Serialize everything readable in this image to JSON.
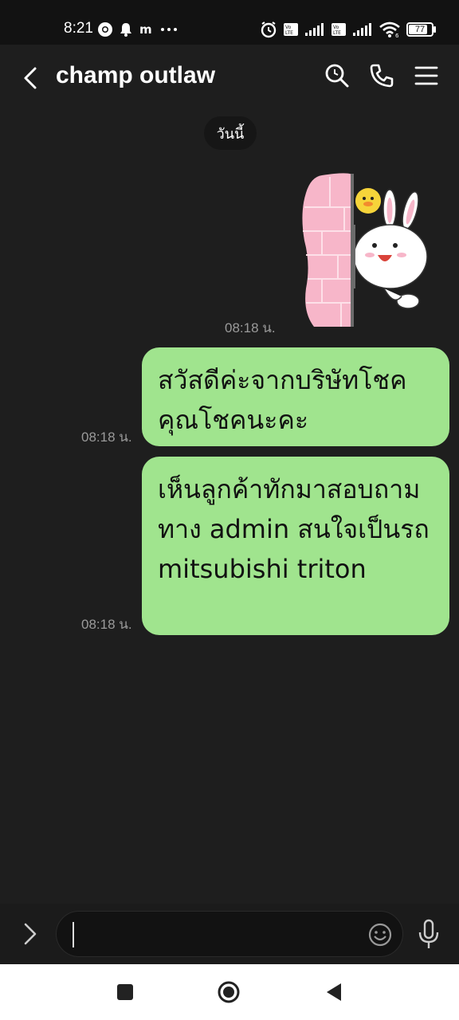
{
  "status": {
    "time": "8:21",
    "battery": "77",
    "icons_left": [
      "chrome-icon",
      "bell-icon",
      "m-app-icon",
      "more-icon"
    ],
    "icons_right": [
      "alarm-icon",
      "volte-icon",
      "signal-icon",
      "volte-icon",
      "signal-icon",
      "wifi-icon",
      "battery-icon"
    ]
  },
  "header": {
    "title": "champ outlaw",
    "icons": [
      "back-icon",
      "search-icon",
      "phone-icon",
      "menu-icon"
    ]
  },
  "chat": {
    "date_label": "วันนี้",
    "messages": [
      {
        "type": "sticker",
        "time": "08:18 น."
      },
      {
        "type": "text",
        "text": "สวัสดีค่ะจากบริษัทโชคคุณโชคนะคะ",
        "time": "08:18 น."
      },
      {
        "type": "text",
        "text": "เห็นลูกค้าทักมาสอบถามทาง admin สนใจเป็นรถ mitsubishi triton",
        "time": "08:18 น."
      }
    ]
  },
  "input": {
    "value": "",
    "icons": [
      "chevron-right-icon",
      "emoji-icon",
      "mic-icon"
    ]
  },
  "nav": {
    "icons": [
      "recents-icon",
      "home-icon",
      "back-icon"
    ]
  },
  "colors": {
    "background": "#1e1e1e",
    "bubble": "#a0e48e",
    "status_bar": "#121212",
    "nav_bar": "#ffffff"
  }
}
